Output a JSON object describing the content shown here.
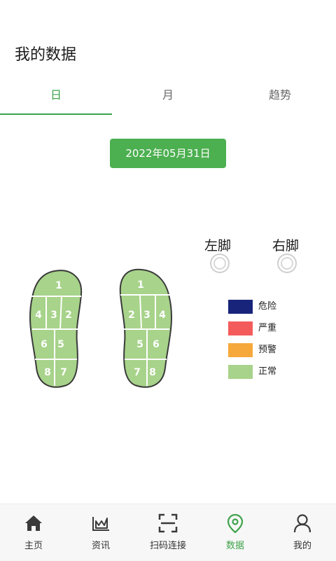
{
  "page_title": "我的数据",
  "tabs": [
    {
      "label": "日",
      "active": true
    },
    {
      "label": "月",
      "active": false
    },
    {
      "label": "趋势",
      "active": false
    }
  ],
  "date_button": "2022年05月31日",
  "feet": {
    "left_label": "左脚",
    "right_label": "右脚",
    "left_zones": [
      "1",
      "4",
      "3",
      "2",
      "6",
      "5",
      "8",
      "7"
    ],
    "right_zones": [
      "1",
      "2",
      "3",
      "4",
      "5",
      "6",
      "7",
      "8"
    ],
    "zone_color": "#a7d38a"
  },
  "legend": [
    {
      "label": "危险",
      "color": "#18247a"
    },
    {
      "label": "严重",
      "color": "#f45b5b"
    },
    {
      "label": "预警",
      "color": "#f7a83a"
    },
    {
      "label": "正常",
      "color": "#a7d38a"
    }
  ],
  "bottom_nav": [
    {
      "label": "主页",
      "icon": "home-icon",
      "active": false
    },
    {
      "label": "资讯",
      "icon": "news-icon",
      "active": false
    },
    {
      "label": "扫码连接",
      "icon": "scan-icon",
      "active": false
    },
    {
      "label": "数据",
      "icon": "location-pin-icon",
      "active": true
    },
    {
      "label": "我的",
      "icon": "user-icon",
      "active": false
    }
  ],
  "colors": {
    "accent": "#3ea34a",
    "button": "#4caf50"
  }
}
